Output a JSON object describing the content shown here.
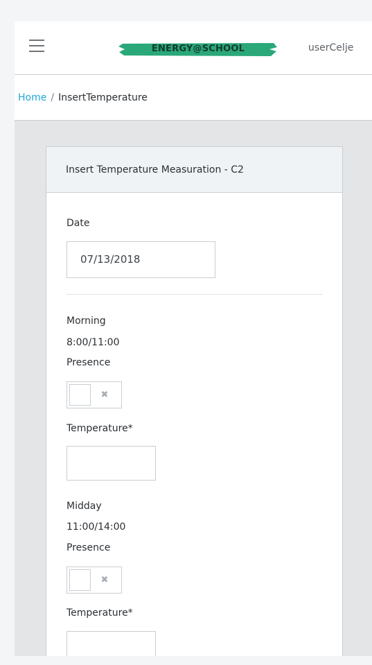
{
  "header": {
    "menu_icon": "hamburger-icon",
    "logo_text": "ENERGY@SCHOOL",
    "logo_color": "#2aa87a",
    "user": "userCelje"
  },
  "breadcrumb": {
    "home": "Home",
    "separator": "/",
    "current": "InsertTemperature"
  },
  "card": {
    "title": "Insert Temperature Measuration - C2",
    "date_label": "Date",
    "date_value": "07/13/2018",
    "periods": [
      {
        "name": "Morning",
        "time": "8:00/11:00",
        "presence_label": "Presence",
        "presence_state_icon": "x-icon",
        "temperature_label": "Temperature*",
        "temperature_value": ""
      },
      {
        "name": "Midday",
        "time": "11:00/14:00",
        "presence_label": "Presence",
        "presence_state_icon": "x-icon",
        "temperature_label": "Temperature*",
        "temperature_value": ""
      }
    ]
  },
  "colors": {
    "link": "#20a8d8",
    "border": "#c8ced3",
    "card_header_bg": "#f0f3f5",
    "page_bg": "#e4e5e6"
  }
}
